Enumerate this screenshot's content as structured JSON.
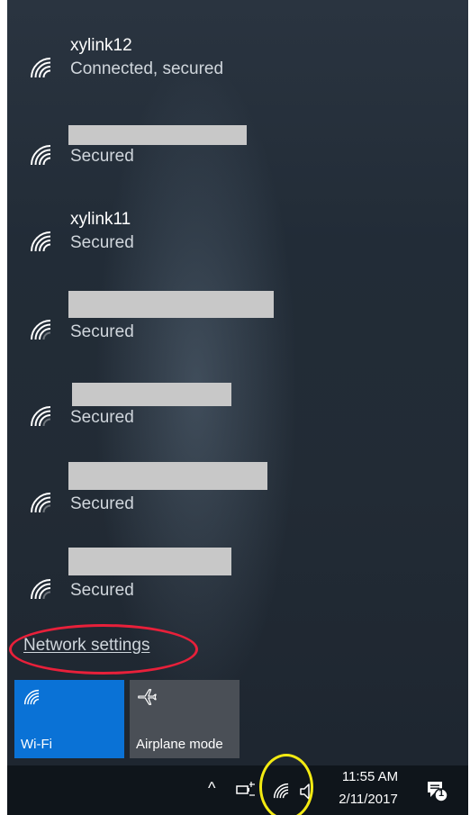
{
  "networks": [
    {
      "ssid": "xylink12",
      "status": "Connected, secured"
    },
    {
      "ssid": "",
      "status": "Secured"
    },
    {
      "ssid": "xylink11",
      "status": "Secured"
    },
    {
      "ssid": "",
      "status": "Secured"
    },
    {
      "ssid": "",
      "status": "Secured"
    },
    {
      "ssid": "",
      "status": "Secured"
    },
    {
      "ssid": "",
      "status": "Secured"
    }
  ],
  "network_settings_label": "Network settings",
  "quick_actions": {
    "wifi": {
      "label": "Wi-Fi",
      "icon": "wifi-icon",
      "state": "on"
    },
    "airplane": {
      "label": "Airplane mode",
      "icon": "airplane-icon",
      "state": "off"
    }
  },
  "taskbar": {
    "chevron": "^",
    "time": "11:55 AM",
    "date": "2/11/2017",
    "notification_count": "1"
  },
  "colors": {
    "accent": "#0a72d6",
    "annotation_red": "#e8203a",
    "annotation_yellow": "#f3ea12"
  }
}
